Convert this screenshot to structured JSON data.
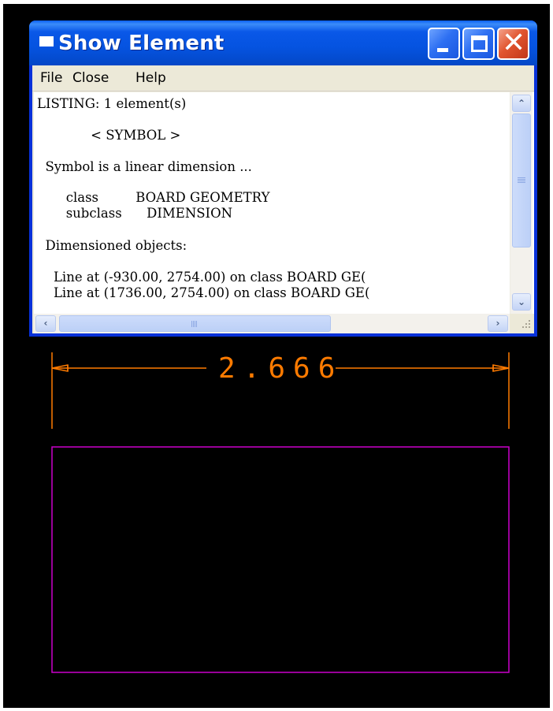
{
  "window": {
    "title": "Show Element",
    "menu": [
      "File",
      "Close",
      "Help"
    ],
    "listing": [
      "LISTING: 1 element(s)",
      "             < SYMBOL >",
      "  Symbol is a linear dimension ...",
      "       class         BOARD GEOMETRY",
      "       subclass      DIMENSION",
      "  Dimensioned objects:",
      "    Line at (-930.00, 2754.00) on class BOARD GE(",
      "    Line at (1736.00, 2754.00) on class BOARD GE("
    ]
  },
  "drawing": {
    "dimension_value": "2.666",
    "dimension_color": "#ff7b00",
    "outline_color": "#cc00cc"
  }
}
